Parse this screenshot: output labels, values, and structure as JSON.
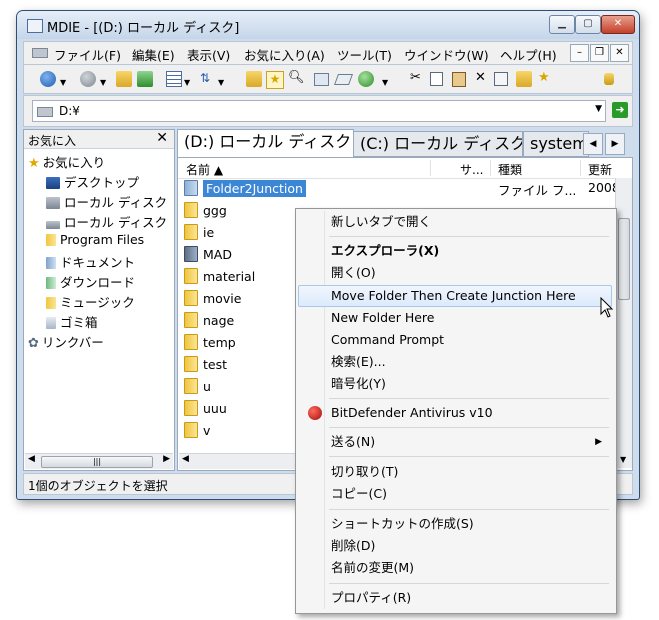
{
  "window": {
    "title": "MDIE - [(D:) ローカル ディスク]",
    "minimize": "▁",
    "maximize": "▢",
    "close": "✕"
  },
  "menubar": {
    "items": [
      {
        "label": "ファイル(F)"
      },
      {
        "label": "編集(E)"
      },
      {
        "label": "表示(V)"
      },
      {
        "label": "お気に入り(A)"
      },
      {
        "label": "ツール(T)"
      },
      {
        "label": "ウインドウ(W)"
      },
      {
        "label": "ヘルプ(H)"
      }
    ],
    "mdi_min": "–",
    "mdi_restore": "❐",
    "mdi_close": "✕"
  },
  "toolbar": {
    "icons": [
      "back-icon",
      "forward-icon",
      "up-folder-icon",
      "refresh-icon",
      "view-icon",
      "sort-icon",
      "folder-icon",
      "favorites-star-icon",
      "search-icon",
      "image-icon",
      "eraser-icon",
      "globe-icon",
      "cut-icon",
      "copy-icon",
      "paste-icon",
      "delete-icon",
      "properties-icon",
      "new-folder-icon",
      "star-icon",
      "lock-icon"
    ]
  },
  "address": {
    "value": "D:¥"
  },
  "favorites": {
    "header": "お気に入",
    "close": "✕",
    "items": [
      {
        "label": "お気に入り",
        "icon": "star-icon"
      },
      {
        "label": "デスクトップ",
        "icon": "desktop-icon"
      },
      {
        "label": "ローカル ディスク",
        "icon": "drive-icon"
      },
      {
        "label": "ローカル ディスク",
        "icon": "drive-icon"
      },
      {
        "label": "Program Files",
        "icon": "folder-icon"
      },
      {
        "label": "ドキュメント",
        "icon": "documents-icon"
      },
      {
        "label": "ダウンロード",
        "icon": "downloads-icon"
      },
      {
        "label": "ミュージック",
        "icon": "music-folder-icon"
      },
      {
        "label": "ゴミ箱",
        "icon": "recycle-bin-icon"
      },
      {
        "label": "リンクバー",
        "icon": "links-icon"
      }
    ],
    "scroll_grip": "|||"
  },
  "tabs": [
    {
      "label": "(D:) ローカル ディスク"
    },
    {
      "label": "(C:) ローカル ディスク"
    },
    {
      "label": "system"
    }
  ],
  "list": {
    "columns": [
      {
        "label": "名前 ▲"
      },
      {
        "label": "サ..."
      },
      {
        "label": "種類"
      },
      {
        "label": "更新"
      }
    ],
    "rows": [
      {
        "name": "Folder2Junction",
        "type": "ファイル フ...",
        "date": "2008"
      },
      {
        "name": "ggg"
      },
      {
        "name": "ie"
      },
      {
        "name": "MAD"
      },
      {
        "name": "material"
      },
      {
        "name": "movie"
      },
      {
        "name": "nage"
      },
      {
        "name": "temp"
      },
      {
        "name": "test"
      },
      {
        "name": "u"
      },
      {
        "name": "uuu"
      },
      {
        "name": "v"
      }
    ]
  },
  "status": {
    "text": "1個のオブジェクトを選択"
  },
  "context_menu": {
    "items": [
      {
        "label": "新しいタブで開く"
      },
      {
        "label": "エクスプローラ(X)"
      },
      {
        "label": "開く(O)"
      },
      {
        "label": "Move Folder Then Create Junction Here"
      },
      {
        "label": "New Folder Here"
      },
      {
        "label": "Command Prompt"
      },
      {
        "label": "検索(E)..."
      },
      {
        "label": "暗号化(Y)"
      },
      {
        "label": "BitDefender Antivirus v10"
      },
      {
        "label": "送る(N)"
      },
      {
        "label": "切り取り(T)"
      },
      {
        "label": "コピー(C)"
      },
      {
        "label": "ショートカットの作成(S)"
      },
      {
        "label": "削除(D)"
      },
      {
        "label": "名前の変更(M)"
      },
      {
        "label": "プロパティ(R)"
      }
    ],
    "submenu_arrow": "▶"
  }
}
